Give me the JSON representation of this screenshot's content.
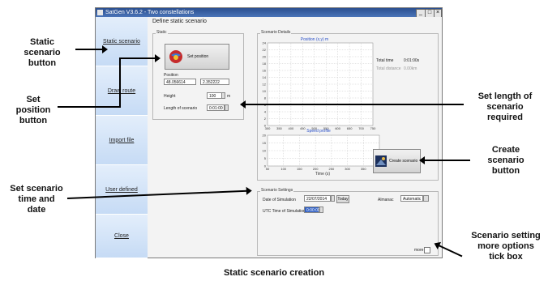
{
  "window": {
    "title": "SatGen V3.6.2 - Two constellations",
    "minimize": "_",
    "maximize": "□",
    "close": "×"
  },
  "nav": {
    "items": [
      {
        "label": "Static scenario"
      },
      {
        "label": "Draw route"
      },
      {
        "label": "Import file"
      },
      {
        "label": "User defined"
      },
      {
        "label": "Close"
      }
    ]
  },
  "main": {
    "heading": "Define static scenario",
    "static_group": "Static",
    "set_position_label": "Set position",
    "position_label": "Position",
    "latitude": "48.056614",
    "longitude": "2.352222",
    "height_label": "Height",
    "height_value": "100",
    "height_unit": "m",
    "length_label": "Length of scenario",
    "length_value": "0:01:00"
  },
  "details": {
    "group": "Scenario Details",
    "total_time_label": "Total time",
    "total_time_value": "0:01:00s",
    "total_distance_label": "Total distance",
    "total_distance_value": "0.00km",
    "create_label": "Create scenario"
  },
  "settings": {
    "group": "Scenario Settings",
    "date_label": "Date of Simulation",
    "date_value": "22/07/2014",
    "today_label": "Today",
    "almanac_label": "Almanac",
    "almanac_value": "Automatic",
    "utc_label": "UTC Time of Simulation",
    "utc_value": "0:00:00",
    "more_label": "more"
  },
  "chart_data": [
    {
      "type": "line",
      "title": "Position (x,y) m",
      "xlim": [
        300,
        700
      ],
      "ylim": [
        0,
        24
      ],
      "xticks": [
        "300",
        "350",
        "400",
        "450",
        "500",
        "550",
        "600",
        "650",
        "700",
        "750"
      ],
      "yticks": [
        "24",
        "22",
        "20",
        "18",
        "16",
        "14",
        "12",
        "10",
        "8",
        "6",
        "4",
        "2",
        "0"
      ],
      "series": []
    },
    {
      "type": "line",
      "title": "Speed profile",
      "xlabel": "Time (s)",
      "xlim": [
        0,
        400
      ],
      "ylim": [
        0,
        20
      ],
      "xticks": [
        "50",
        "100",
        "150",
        "200",
        "250",
        "300",
        "350",
        "400"
      ],
      "yticks": [
        "20",
        "15",
        "10",
        "5",
        "0"
      ],
      "series": []
    }
  ],
  "callouts": {
    "static_scenario": [
      "Static",
      "scenario",
      "button"
    ],
    "set_position": [
      "Set",
      "position",
      "button"
    ],
    "length": [
      "Set length of",
      "scenario",
      "required"
    ],
    "create": [
      "Create",
      "scenario",
      "button"
    ],
    "time_date": [
      "Set scenario",
      "time and",
      "date"
    ],
    "more_options": [
      "Scenario setting",
      "more options",
      "tick box"
    ]
  },
  "caption": "Static scenario creation"
}
